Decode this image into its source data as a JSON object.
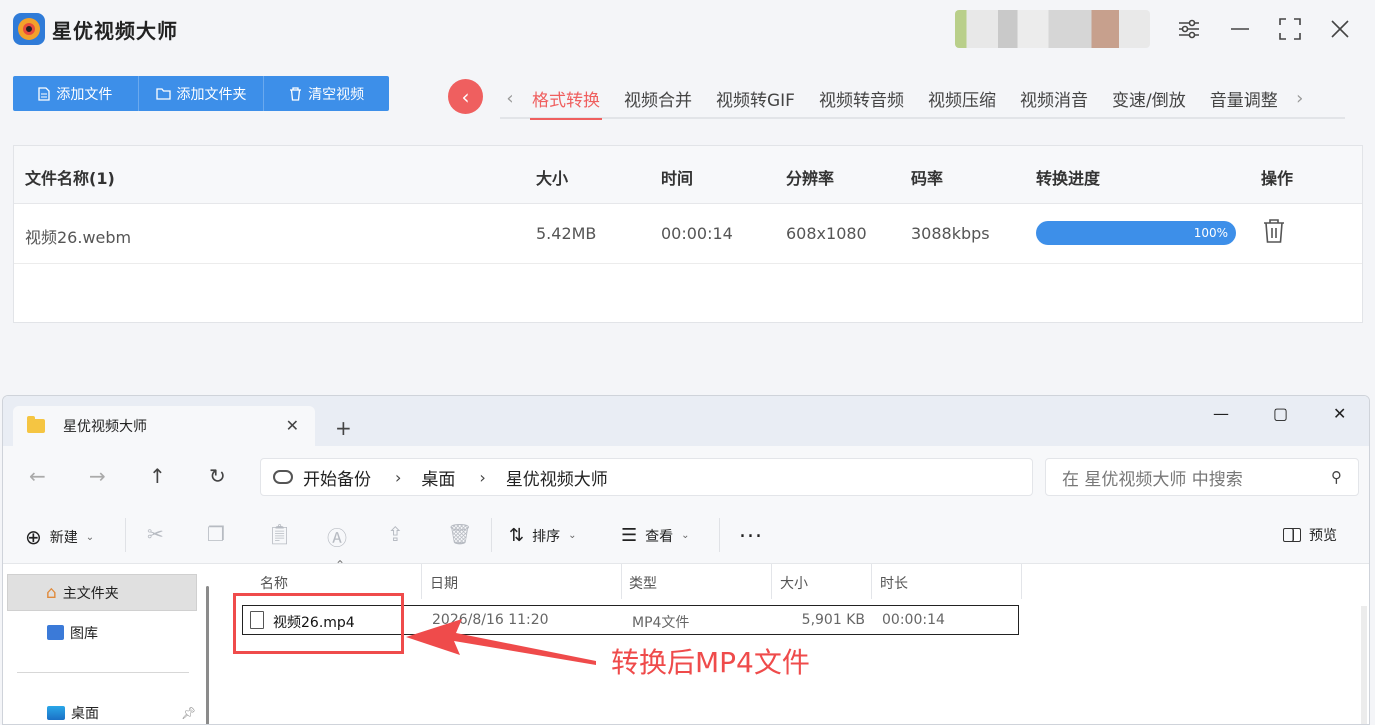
{
  "app": {
    "title": "星优视频大师",
    "window_controls": [
      "settings-sliders-icon",
      "minimize-icon",
      "maximize-icon",
      "close-icon"
    ]
  },
  "toolbar": {
    "add_file": "添加文件",
    "add_folder": "添加文件夹",
    "clear": "清空视频"
  },
  "tabs": {
    "items": [
      "格式转换",
      "视频合并",
      "视频转GIF",
      "视频转音频",
      "视频压缩",
      "视频消音",
      "变速/倒放",
      "音量调整"
    ],
    "active": "格式转换"
  },
  "table": {
    "headers": {
      "name": "文件名称(1)",
      "size": "大小",
      "time": "时间",
      "resolution": "分辨率",
      "bitrate": "码率",
      "progress": "转换进度",
      "action": "操作"
    },
    "rows": [
      {
        "name": "视频26.webm",
        "size": "5.42MB",
        "time": "00:00:14",
        "resolution": "608x1080",
        "bitrate": "3088kbps",
        "progress_label": "100%",
        "progress_value": 100
      }
    ]
  },
  "explorer": {
    "tab_title": "星优视频大师",
    "breadcrumb": [
      "开始备份",
      "桌面",
      "星优视频大师"
    ],
    "search_placeholder": "在 星优视频大师 中搜索",
    "commands": {
      "new": "新建",
      "sort": "排序",
      "view": "查看",
      "more": "...",
      "preview": "预览"
    },
    "sidebar": [
      "主文件夹",
      "图库",
      "桌面"
    ],
    "columns": {
      "name": "名称",
      "date": "日期",
      "type": "类型",
      "size": "大小",
      "duration": "时长"
    },
    "files": [
      {
        "name": "视频26.mp4",
        "date": "2026/8/16 11:20",
        "type": "MP4文件",
        "size": "5,901 KB",
        "duration": "00:00:14"
      }
    ]
  },
  "annotation": {
    "text": "转换后MP4文件",
    "color": "#ef4b4b"
  },
  "colors": {
    "accent_blue": "#3d8fe9",
    "accent_red": "#ef5f5f"
  }
}
